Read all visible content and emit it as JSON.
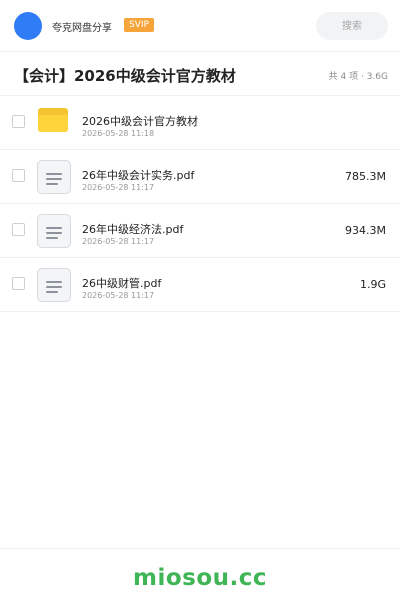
{
  "header": {
    "brand": "夸克网盘分享",
    "badge": "SVIP",
    "search_placeholder": "搜索"
  },
  "titlebar": {
    "title": "【会计】2026中级会计官方教材",
    "summary": "共 4 项 · 3.6G"
  },
  "files": [
    {
      "name": "2026中级会计官方教材",
      "date": "2026-05-28 11:18",
      "size": "",
      "type": "folder"
    },
    {
      "name": "26年中级会计实务.pdf",
      "date": "2026-05-28 11:17",
      "size": "785.3M",
      "type": "pdf"
    },
    {
      "name": "26年中级经济法.pdf",
      "date": "2026-05-28 11:17",
      "size": "934.3M",
      "type": "pdf"
    },
    {
      "name": "26中级财管.pdf",
      "date": "2026-05-28 11:17",
      "size": "1.9G",
      "type": "pdf"
    }
  ],
  "footer": {
    "logo": "miosou.cc"
  },
  "colors": {
    "avatar": "#2f7cf6",
    "badge": "#f7a43a",
    "folder": "#ffd43b",
    "footer_logo": "#3fb556"
  },
  "icons": {
    "avatar": "user-avatar-icon",
    "folder": "folder-icon",
    "pdf": "document-icon",
    "checkbox": "checkbox-icon"
  }
}
